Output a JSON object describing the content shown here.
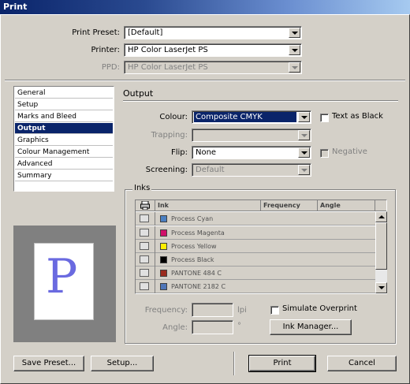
{
  "window": {
    "title": "Print"
  },
  "top": {
    "preset_label": "Print Preset:",
    "preset_value": "[Default]",
    "printer_label": "Printer:",
    "printer_value": "HP Color LaserJet PS",
    "ppd_label": "PPD:",
    "ppd_value": "HP Color LaserJet PS"
  },
  "sidebar": {
    "items": [
      {
        "label": "General"
      },
      {
        "label": "Setup"
      },
      {
        "label": "Marks and Bleed"
      },
      {
        "label": "Output"
      },
      {
        "label": "Graphics"
      },
      {
        "label": "Colour Management"
      },
      {
        "label": "Advanced"
      },
      {
        "label": "Summary"
      }
    ],
    "selected": "Output"
  },
  "preview": {
    "letter": "P"
  },
  "output": {
    "section_title": "Output",
    "colour_label": "Colour:",
    "colour_value": "Composite CMYK",
    "text_as_black_label": "Text as Black",
    "trapping_label": "Trapping:",
    "trapping_value": "",
    "flip_label": "Flip:",
    "flip_value": "None",
    "negative_label": "Negative",
    "screening_label": "Screening:",
    "screening_value": "Default"
  },
  "inks": {
    "group_title": "Inks",
    "columns": [
      "Ink",
      "Frequency",
      "Angle"
    ],
    "rows": [
      {
        "name": "Process Cyan",
        "color": "#4a7fc1"
      },
      {
        "name": "Process Magenta",
        "color": "#d0106a"
      },
      {
        "name": "Process Yellow",
        "color": "#ffee00"
      },
      {
        "name": "Process Black",
        "color": "#000000"
      },
      {
        "name": "PANTONE 484 C",
        "color": "#9a2a1e"
      },
      {
        "name": "PANTONE 2182 C",
        "color": "#4f76b8"
      }
    ],
    "frequency_label": "Frequency:",
    "frequency_unit": "lpi",
    "angle_label": "Angle:",
    "angle_unit": "°",
    "simulate_overprint_label": "Simulate Overprint",
    "ink_manager_label": "Ink Manager..."
  },
  "footer": {
    "save_preset_label": "Save Preset...",
    "setup_label": "Setup...",
    "print_label": "Print",
    "cancel_label": "Cancel"
  }
}
